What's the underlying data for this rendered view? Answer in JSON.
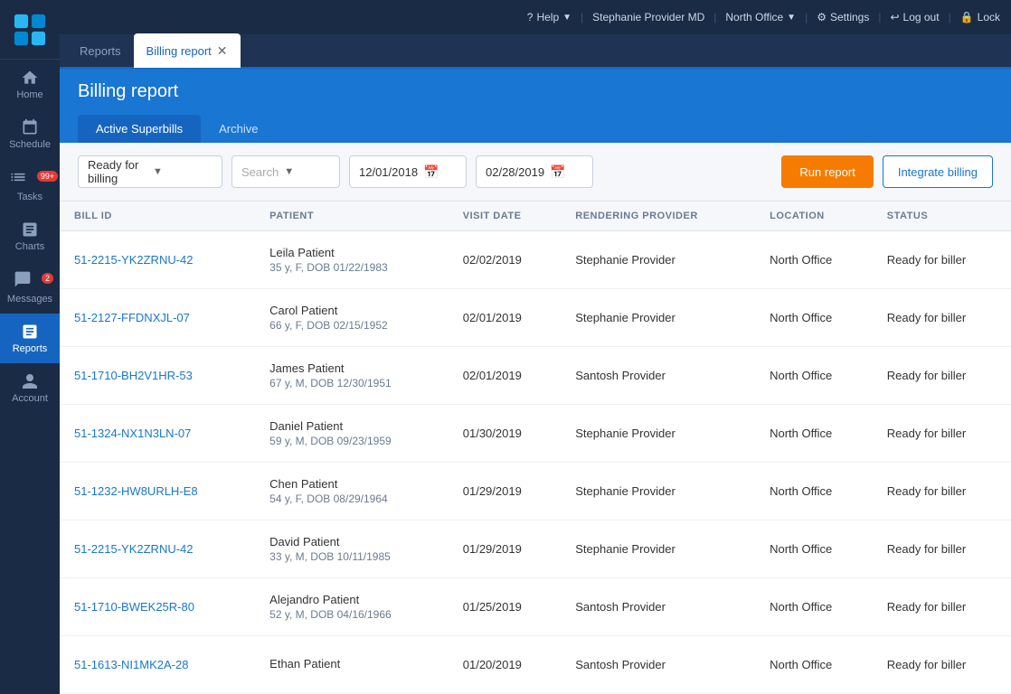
{
  "topbar": {
    "help_label": "Help",
    "user_label": "Stephanie Provider MD",
    "office_label": "North Office",
    "settings_label": "Settings",
    "logout_label": "Log out",
    "lock_label": "Lock"
  },
  "tabs": [
    {
      "id": "reports",
      "label": "Reports",
      "active": false,
      "closable": false
    },
    {
      "id": "billing-report",
      "label": "Billing report",
      "active": true,
      "closable": true
    }
  ],
  "page": {
    "title": "Billing report"
  },
  "subtabs": [
    {
      "id": "active-superbills",
      "label": "Active Superbills",
      "active": true
    },
    {
      "id": "archive",
      "label": "Archive",
      "active": false
    }
  ],
  "filters": {
    "status_value": "Ready for billing",
    "search_placeholder": "Search",
    "date_from": "12/01/2018",
    "date_to": "02/28/2019",
    "run_report_label": "Run report",
    "integrate_billing_label": "Integrate billing"
  },
  "table": {
    "columns": [
      {
        "id": "bill_id",
        "label": "BILL ID"
      },
      {
        "id": "patient",
        "label": "PATIENT"
      },
      {
        "id": "visit_date",
        "label": "VISIT DATE"
      },
      {
        "id": "rendering_provider",
        "label": "RENDERING PROVIDER"
      },
      {
        "id": "location",
        "label": "LOCATION"
      },
      {
        "id": "status",
        "label": "STATUS"
      }
    ],
    "rows": [
      {
        "bill_id": "51-2215-YK2ZRNU-42",
        "patient_name": "Leila Patient",
        "patient_info": "35 y, F, DOB 01/22/1983",
        "visit_date": "02/02/2019",
        "rendering_provider": "Stephanie Provider",
        "location": "North Office",
        "status": "Ready for biller"
      },
      {
        "bill_id": "51-2127-FFDNXJL-07",
        "patient_name": "Carol Patient",
        "patient_info": "66 y, F, DOB 02/15/1952",
        "visit_date": "02/01/2019",
        "rendering_provider": "Stephanie Provider",
        "location": "North Office",
        "status": "Ready for biller"
      },
      {
        "bill_id": "51-1710-BH2V1HR-53",
        "patient_name": "James Patient",
        "patient_info": "67 y, M, DOB 12/30/1951",
        "visit_date": "02/01/2019",
        "rendering_provider": "Santosh Provider",
        "location": "North Office",
        "status": "Ready for biller"
      },
      {
        "bill_id": "51-1324-NX1N3LN-07",
        "patient_name": "Daniel Patient",
        "patient_info": "59 y, M, DOB 09/23/1959",
        "visit_date": "01/30/2019",
        "rendering_provider": "Stephanie Provider",
        "location": "North Office",
        "status": "Ready for biller"
      },
      {
        "bill_id": "51-1232-HW8URLH-E8",
        "patient_name": "Chen Patient",
        "patient_info": "54 y, F, DOB 08/29/1964",
        "visit_date": "01/29/2019",
        "rendering_provider": "Stephanie Provider",
        "location": "North Office",
        "status": "Ready for biller"
      },
      {
        "bill_id": "51-2215-YK2ZRNU-42",
        "patient_name": "David Patient",
        "patient_info": "33 y, M, DOB 10/11/1985",
        "visit_date": "01/29/2019",
        "rendering_provider": "Stephanie Provider",
        "location": "North Office",
        "status": "Ready for biller"
      },
      {
        "bill_id": "51-1710-BWEK25R-80",
        "patient_name": "Alejandro Patient",
        "patient_info": "52 y, M, DOB 04/16/1966",
        "visit_date": "01/25/2019",
        "rendering_provider": "Santosh Provider",
        "location": "North Office",
        "status": "Ready for biller"
      },
      {
        "bill_id": "51-1613-NI1MK2A-28",
        "patient_name": "Ethan Patient",
        "patient_info": "",
        "visit_date": "01/20/2019",
        "rendering_provider": "Santosh Provider",
        "location": "North Office",
        "status": "Ready for biller"
      }
    ]
  },
  "sidebar": {
    "items": [
      {
        "id": "home",
        "label": "Home",
        "icon": "home"
      },
      {
        "id": "schedule",
        "label": "Schedule",
        "icon": "calendar"
      },
      {
        "id": "tasks",
        "label": "Tasks",
        "icon": "tasks",
        "badge": "99+"
      },
      {
        "id": "charts",
        "label": "Charts",
        "icon": "charts"
      },
      {
        "id": "messages",
        "label": "Messages",
        "icon": "messages",
        "badge": "2"
      },
      {
        "id": "reports",
        "label": "Reports",
        "icon": "reports",
        "active": true
      },
      {
        "id": "account",
        "label": "Account",
        "icon": "account"
      }
    ]
  }
}
